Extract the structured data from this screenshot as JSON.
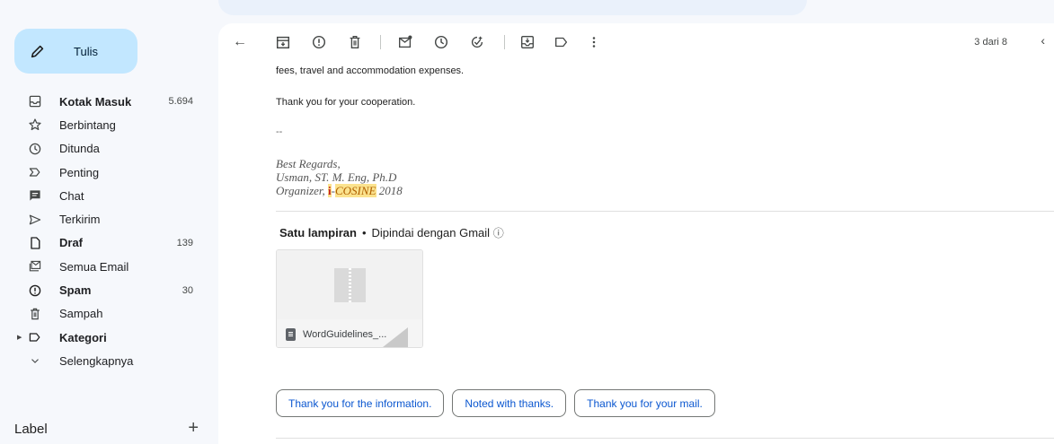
{
  "sidebar": {
    "compose_label": "Tulis",
    "items": [
      {
        "label": "Kotak Masuk",
        "count": "5.694",
        "bold": true,
        "icon": "inbox-icon"
      },
      {
        "label": "Berbintang",
        "count": "",
        "bold": false,
        "icon": "star-icon"
      },
      {
        "label": "Ditunda",
        "count": "",
        "bold": false,
        "icon": "clock-icon"
      },
      {
        "label": "Penting",
        "count": "",
        "bold": false,
        "icon": "important-icon"
      },
      {
        "label": "Chat",
        "count": "",
        "bold": false,
        "icon": "chat-icon"
      },
      {
        "label": "Terkirim",
        "count": "",
        "bold": false,
        "icon": "send-icon"
      },
      {
        "label": "Draf",
        "count": "139",
        "bold": true,
        "icon": "draft-icon"
      },
      {
        "label": "Semua Email",
        "count": "",
        "bold": false,
        "icon": "all-mail-icon"
      },
      {
        "label": "Spam",
        "count": "30",
        "bold": true,
        "icon": "spam-icon"
      },
      {
        "label": "Sampah",
        "count": "",
        "bold": false,
        "icon": "trash-icon"
      },
      {
        "label": "Kategori",
        "count": "",
        "bold": true,
        "icon": "label-icon"
      },
      {
        "label": "Selengkapnya",
        "count": "",
        "bold": false,
        "icon": "chevron-down-icon"
      }
    ],
    "label_heading": "Label",
    "label_add": "+"
  },
  "toolbar": {
    "back": "←",
    "pager": "3 dari 8",
    "prev": "‹"
  },
  "email": {
    "line1": "fees, travel and accommodation expenses.",
    "line2": "Thank you for your cooperation.",
    "line3": "--",
    "sig1": "Best Regards,",
    "sig2": "Usman, ST. M. Eng, Ph.D",
    "sig3_prefix": "Organizer, ",
    "sig3_hl1": "i",
    "sig3_dash": "-",
    "sig3_hl2": "COSINE",
    "sig3_suffix": " 2018"
  },
  "attachments": {
    "heading": "Satu lampiran",
    "dot": "•",
    "scanned": "Dipindai dengan Gmail",
    "info_icon": "ⓘ",
    "file_name": "WordGuidelines_..."
  },
  "smart_replies": [
    "Thank you for the information.",
    "Noted with thanks.",
    "Thank you for your mail."
  ],
  "colors": {
    "compose_bg": "#c2e7ff",
    "accent": "#0b57d0",
    "highlight": "#fbe38e"
  }
}
